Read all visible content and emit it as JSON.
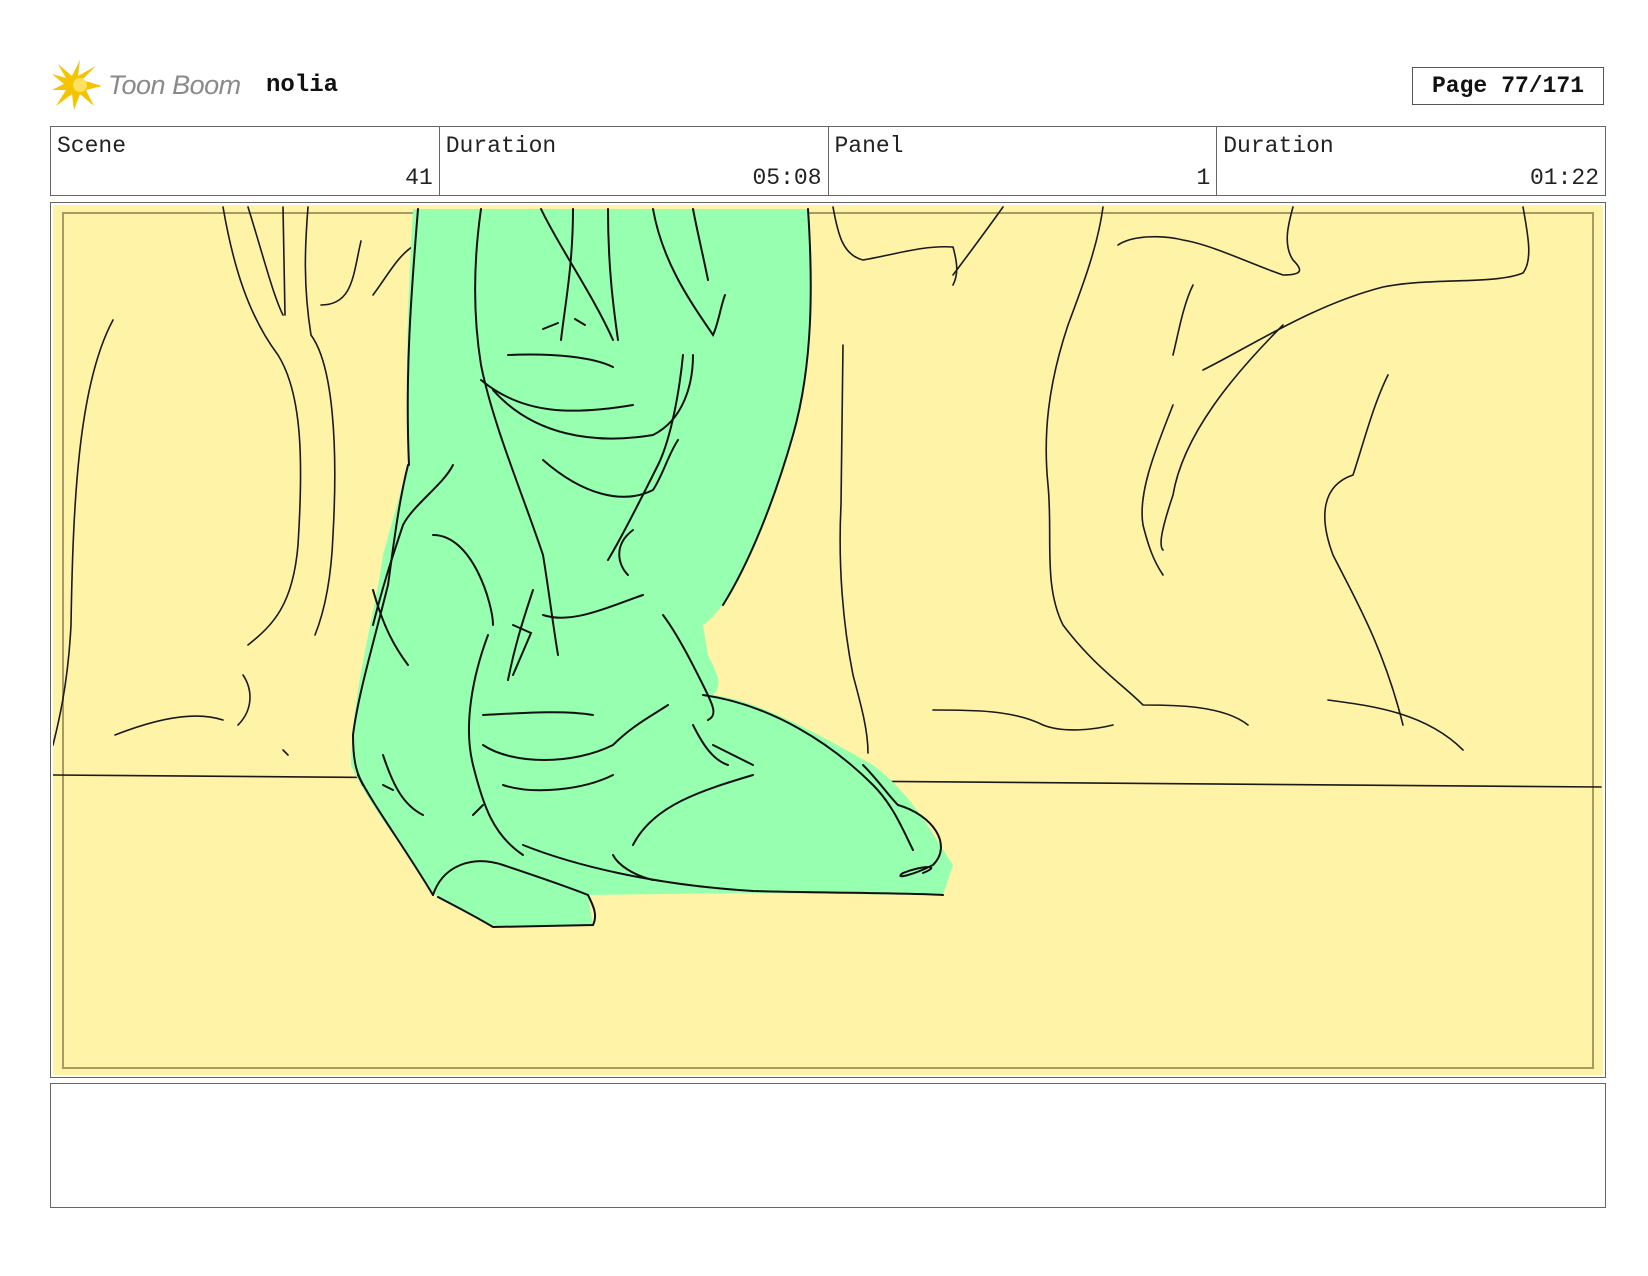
{
  "header": {
    "logo_text": "Toon Boom",
    "project_name": "nolia",
    "page_label": "Page",
    "page_value": "77/171"
  },
  "info": {
    "scene_label": "Scene",
    "scene_value": "41",
    "scene_duration_label": "Duration",
    "scene_duration_value": "05:08",
    "panel_label": "Panel",
    "panel_value": "1",
    "panel_duration_label": "Duration",
    "panel_duration_value": "01:22"
  },
  "colors": {
    "background_fill": "#fff3a8",
    "figure_fill": "#96ffb0",
    "safe_frame": "#a89a63",
    "logo_accent": "#f5c400"
  }
}
